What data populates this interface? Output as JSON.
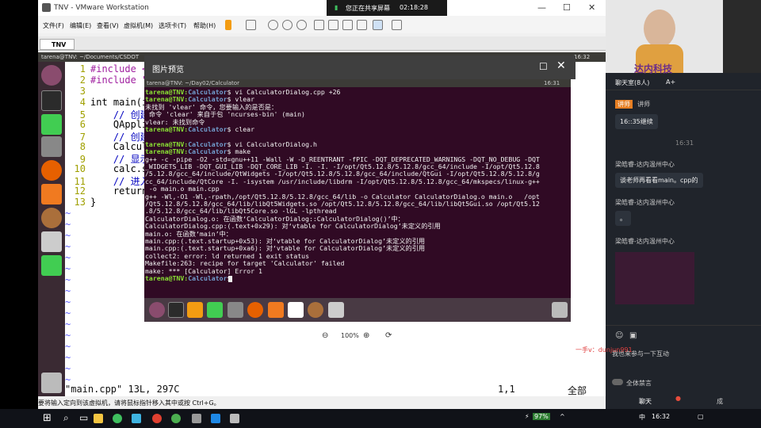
{
  "vmware": {
    "title": "TNV - VMware Workstation",
    "menu": [
      "文件(F)",
      "编辑(E)",
      "查看(V)",
      "虚拟机(M)",
      "选项卡(T)",
      "帮助(H)"
    ],
    "tab": "TNV",
    "status_hint": "要将输入定向到该虚拟机，请将鼠标指针移入其中或按 Ctrl+G。"
  },
  "share_banner": {
    "text": "您正在共享屏幕",
    "time": "02:18:28"
  },
  "ubuntu": {
    "window_title": "tarena@TNV: ~/Documents/CSDOT",
    "clock": "16:32"
  },
  "vim": {
    "lines": [
      {
        "n": "1",
        "text": "#include <Q"
      },
      {
        "n": "2",
        "text": "#include \"C"
      },
      {
        "n": "3",
        "text": ""
      },
      {
        "n": "4",
        "text": "int main(in"
      },
      {
        "n": "5",
        "text": "    // 创建"
      },
      {
        "n": "6",
        "text": "    QApplic"
      },
      {
        "n": "7",
        "text": "    // 创建"
      },
      {
        "n": "8",
        "text": "    Calcula"
      },
      {
        "n": "9",
        "text": "    // 显示"
      },
      {
        "n": "10",
        "text": "    calc.sh"
      },
      {
        "n": "11",
        "text": "    // 进入"
      },
      {
        "n": "12",
        "text": "    return "
      },
      {
        "n": "13",
        "text": "}"
      }
    ],
    "tilde": "~",
    "status_file": "\"main.cpp\" 13L, 297C",
    "status_pos": "1,1",
    "status_all": "全部"
  },
  "preview": {
    "title": "图片预览",
    "zoom": "100%",
    "terminal_title": "tarena@TNV: ~/Day02/Calculator",
    "terminal_clock": "16:31",
    "terminal_lines": [
      {
        "u": "tarena@TNV:",
        "d": "Calculator",
        "t": "$ vi CalculatorDialog.cpp +26"
      },
      {
        "u": "tarena@TNV:",
        "d": "Calculator",
        "t": "$ vlear"
      },
      {
        "u": "",
        "d": "",
        "t": "未找到 'vlear' 命令，您要输入的是否是："
      },
      {
        "u": "",
        "d": "",
        "t": " 命令 'clear' 来自于包 'ncurses-bin' (main)"
      },
      {
        "u": "",
        "d": "",
        "t": "vlear: 未找到命令"
      },
      {
        "u": "tarena@TNV:",
        "d": "Calculator",
        "t": "$ clear"
      },
      {
        "u": "",
        "d": "",
        "t": ""
      },
      {
        "u": "tarena@TNV:",
        "d": "Calculator",
        "t": "$ vi CalculatorDialog.h"
      },
      {
        "u": "tarena@TNV:",
        "d": "Calculator",
        "t": "$ make"
      },
      {
        "u": "",
        "d": "",
        "t": "g++ -c -pipe -O2 -std=gnu++11 -Wall -W -D_REENTRANT -fPIC -DQT_DEPRECATED_WARNINGS -DQT_NO_DEBUG -DQT"
      },
      {
        "u": "",
        "d": "",
        "t": "_WIDGETS_LIB -DQT_GUI_LIB -DQT_CORE_LIB -I. -I. -I/opt/Qt5.12.8/5.12.8/gcc_64/include -I/opt/Qt5.12.8"
      },
      {
        "u": "",
        "d": "",
        "t": "/5.12.8/gcc_64/include/QtWidgets -I/opt/Qt5.12.8/5.12.8/gcc_64/include/QtGui -I/opt/Qt5.12.8/5.12.8/g"
      },
      {
        "u": "",
        "d": "",
        "t": "cc_64/include/QtCore -I. -isystem /usr/include/libdrm -I/opt/Qt5.12.8/5.12.8/gcc_64/mkspecs/linux-g++"
      },
      {
        "u": "",
        "d": "",
        "t": " -o main.o main.cpp"
      },
      {
        "u": "",
        "d": "",
        "t": "g++ -Wl,-O1 -Wl,-rpath,/opt/Qt5.12.8/5.12.8/gcc_64/lib -o Calculator CalculatorDialog.o main.o   /opt"
      },
      {
        "u": "",
        "d": "",
        "t": "/Qt5.12.8/5.12.8/gcc_64/lib/libQt5Widgets.so /opt/Qt5.12.8/5.12.8/gcc_64/lib/libQt5Gui.so /opt/Qt5.12"
      },
      {
        "u": "",
        "d": "",
        "t": ".8/5.12.8/gcc_64/lib/libQt5Core.so -lGL -lpthread"
      },
      {
        "u": "",
        "d": "",
        "t": "CalculatorDialog.o: 在函数‘CalculatorDialog::CalculatorDialog()’中："
      },
      {
        "u": "",
        "d": "",
        "t": "CalculatorDialog.cpp:(.text+0x29): 对‘vtable for CalculatorDialog’未定义的引用"
      },
      {
        "u": "",
        "d": "",
        "t": "main.o: 在函数‘main’中："
      },
      {
        "u": "",
        "d": "",
        "t": "main.cpp:(.text.startup+0x53): 对‘vtable for CalculatorDialog’未定义的引用"
      },
      {
        "u": "",
        "d": "",
        "t": "main.cpp:(.text.startup+0xa6): 对‘vtable for CalculatorDialog’未定义的引用"
      },
      {
        "u": "",
        "d": "",
        "t": "collect2: error: ld returned 1 exit status"
      },
      {
        "u": "",
        "d": "",
        "t": "Makefile:263: recipe for target 'Calculator' failed"
      },
      {
        "u": "",
        "d": "",
        "t": "make: *** [Calculator] Error 1"
      },
      {
        "u": "tarena@TNV:",
        "d": "Calculator",
        "t": "$ "
      }
    ]
  },
  "chat": {
    "brand": "达内科技",
    "room": "聊天室(8人)",
    "font_btn": "A+",
    "messages": [
      {
        "badge": "讲师",
        "name": "讲师",
        "text": "16::35继续"
      },
      {
        "name": "",
        "text": "16:31"
      },
      {
        "name": "梁皓睿-达内温州中心",
        "text": "谈老师再看看main。cpp的"
      },
      {
        "name": "梁皓睿-达内温州中心",
        "text": "。"
      },
      {
        "name": "梁皓睿-达内温州中心",
        "text": ""
      }
    ],
    "watermark": "一手v：dunjun991",
    "hint": "我也来参与一下互动",
    "mute_label": "全体禁言",
    "tab_chat": "聊天",
    "tab_more": "成"
  },
  "taskbar": {
    "battery": "97%",
    "time": "16:32",
    "ime": "中"
  }
}
